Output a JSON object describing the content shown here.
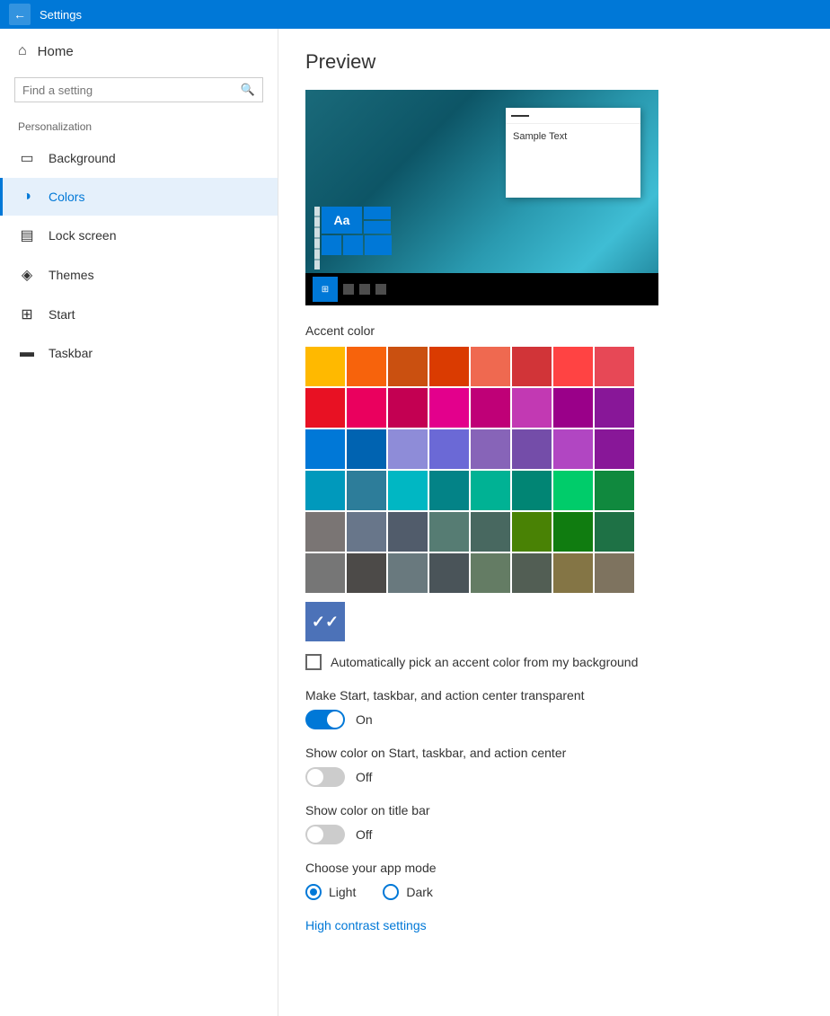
{
  "titleBar": {
    "title": "Settings",
    "backLabel": "←"
  },
  "sidebar": {
    "homeLabel": "Home",
    "searchPlaceholder": "Find a setting",
    "sectionLabel": "Personalization",
    "items": [
      {
        "id": "background",
        "label": "Background",
        "icon": "🖼"
      },
      {
        "id": "colors",
        "label": "Colors",
        "icon": "🎨",
        "active": true
      },
      {
        "id": "lockscreen",
        "label": "Lock screen",
        "icon": "🔒"
      },
      {
        "id": "themes",
        "label": "Themes",
        "icon": "🎭"
      },
      {
        "id": "start",
        "label": "Start",
        "icon": "⊞"
      },
      {
        "id": "taskbar",
        "label": "Taskbar",
        "icon": "▬"
      }
    ]
  },
  "main": {
    "pageTitle": "Preview",
    "preview": {
      "sampleText": "Sample Text",
      "aaLabel": "Aa"
    },
    "accentColor": {
      "label": "Accent color",
      "colors": [
        "#FFB900",
        "#F7630C",
        "#CA5010",
        "#DA3B01",
        "#EF6950",
        "#D13438",
        "#FF4343",
        "#E74856",
        "#E81123",
        "#EA005E",
        "#C30052",
        "#E3008C",
        "#BF0077",
        "#C239B3",
        "#9A0089",
        "#881798",
        "#0078D7",
        "#0063B1",
        "#8E8CD8",
        "#6B69D6",
        "#8764B8",
        "#744DA9",
        "#B146C2",
        "#881798",
        "#0099BC",
        "#2D7D9A",
        "#00B7C3",
        "#038387",
        "#00B294",
        "#018574",
        "#00CC6A",
        "#10893E",
        "#7A7574",
        "#68768A",
        "#515C6B",
        "#567C73",
        "#486860",
        "#498205",
        "#107C10",
        "#1E7145",
        "#767676",
        "#4C4A48",
        "#69797E",
        "#4A5459",
        "#647C64",
        "#525E54",
        "#847545",
        "#7E735F"
      ],
      "selectedIndex": 48,
      "customColor": "#4C72B8"
    },
    "autoPickCheckbox": {
      "label": "Automatically pick an accent color from my background",
      "checked": false
    },
    "transparentToggle": {
      "label": "Make Start, taskbar, and action center transparent",
      "state": "on",
      "stateLabel": "On"
    },
    "colorOnStartToggle": {
      "label": "Show color on Start, taskbar, and action center",
      "state": "off",
      "stateLabel": "Off"
    },
    "colorOnTitleBarToggle": {
      "label": "Show color on title bar",
      "state": "off",
      "stateLabel": "Off"
    },
    "appMode": {
      "label": "Choose your app mode",
      "options": [
        "Light",
        "Dark"
      ],
      "selected": "Light"
    },
    "highContrastLink": "High contrast settings"
  }
}
